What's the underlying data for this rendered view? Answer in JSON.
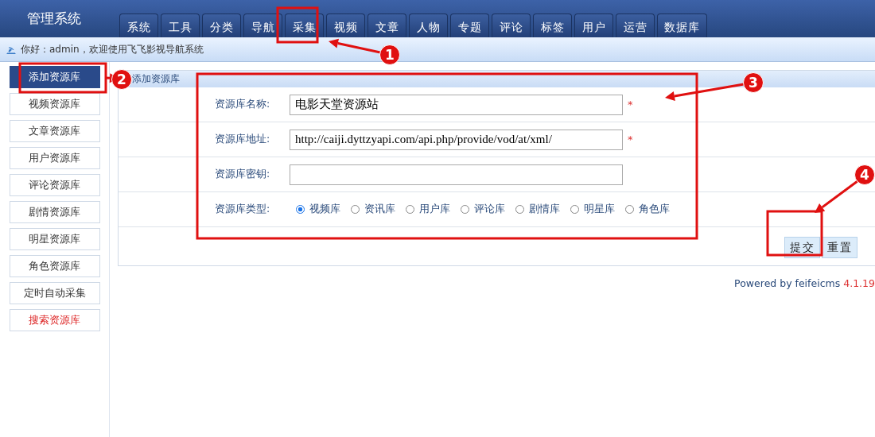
{
  "app_title": "管理系统",
  "nav_tabs": [
    {
      "label": "系统"
    },
    {
      "label": "工具"
    },
    {
      "label": "分类"
    },
    {
      "label": "导航"
    },
    {
      "label": "采集"
    },
    {
      "label": "视频"
    },
    {
      "label": "文章"
    },
    {
      "label": "人物"
    },
    {
      "label": "专题"
    },
    {
      "label": "评论"
    },
    {
      "label": "标签"
    },
    {
      "label": "用户"
    },
    {
      "label": "运营"
    },
    {
      "label": "数据库"
    }
  ],
  "greeting": "你好：admin，欢迎使用飞飞影视导航系统",
  "sidebar": {
    "items": [
      {
        "label": "添加资源库",
        "selected": true,
        "kind": "normal"
      },
      {
        "label": "视频资源库",
        "selected": false,
        "kind": "normal"
      },
      {
        "label": "文章资源库",
        "selected": false,
        "kind": "normal"
      },
      {
        "label": "用户资源库",
        "selected": false,
        "kind": "normal"
      },
      {
        "label": "评论资源库",
        "selected": false,
        "kind": "normal"
      },
      {
        "label": "剧情资源库",
        "selected": false,
        "kind": "normal"
      },
      {
        "label": "明星资源库",
        "selected": false,
        "kind": "normal"
      },
      {
        "label": "角色资源库",
        "selected": false,
        "kind": "normal"
      },
      {
        "label": "定时自动采集",
        "selected": false,
        "kind": "normal"
      },
      {
        "label": "搜索资源库",
        "selected": false,
        "kind": "warning"
      }
    ]
  },
  "form": {
    "title": "添加资源库",
    "fields": [
      {
        "kind": "text",
        "label": "资源库名称:",
        "value": "电影天堂资源站",
        "required_mark": "*"
      },
      {
        "kind": "text",
        "label": "资源库地址:",
        "value": "http://caiji.dyttzyapi.com/api.php/provide/vod/at/xml/",
        "required_mark": "*"
      },
      {
        "kind": "text",
        "label": "资源库密钥:"
      },
      {
        "kind": "radio",
        "label": "资源库类型:",
        "options": [
          {
            "label": "视频库",
            "selected": true
          },
          {
            "label": "资讯库",
            "selected": false
          },
          {
            "label": "用户库",
            "selected": false
          },
          {
            "label": "评论库",
            "selected": false
          },
          {
            "label": "剧情库",
            "selected": false
          },
          {
            "label": "明星库",
            "selected": false
          },
          {
            "label": "角色库",
            "selected": false
          }
        ]
      }
    ],
    "buttons": [
      "提交",
      "重置"
    ]
  },
  "footer": {
    "text": "Powered by feifeicms",
    "version": "4.1.19"
  },
  "annotations": [
    {
      "number": "1"
    },
    {
      "number": "2"
    },
    {
      "number": "3"
    },
    {
      "number": "4"
    }
  ]
}
